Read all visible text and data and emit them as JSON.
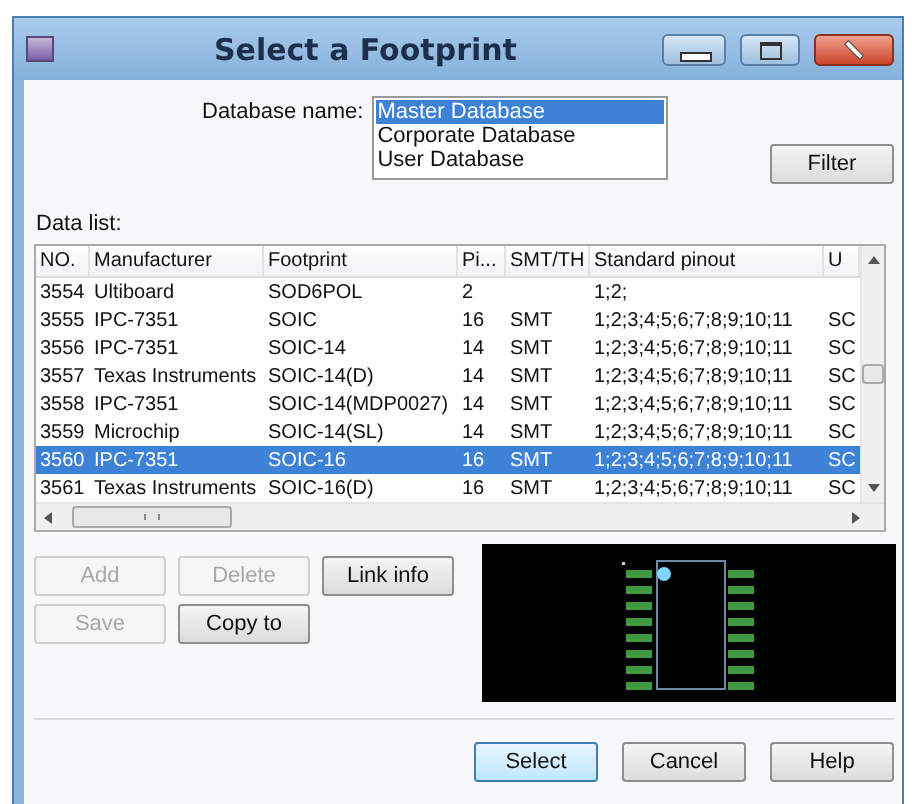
{
  "window": {
    "title": "Select a Footprint"
  },
  "database": {
    "label": "Database name:",
    "items": [
      {
        "label": "Master Database",
        "selected": true
      },
      {
        "label": "Corporate Database",
        "selected": false
      },
      {
        "label": "User Database",
        "selected": false
      }
    ]
  },
  "filter_button": {
    "label": "Filter"
  },
  "data_list": {
    "label": "Data list:",
    "columns": [
      "NO.",
      "Manufacturer",
      "Footprint",
      "Pi...",
      "SMT/TH",
      "Standard pinout",
      "U"
    ],
    "rows": [
      {
        "cells": [
          "3554",
          "Ultiboard",
          "SOD6POL",
          "2",
          "",
          "1;2;",
          ""
        ],
        "selected": false
      },
      {
        "cells": [
          "3555",
          "IPC-7351",
          "SOIC",
          "16",
          "SMT",
          "1;2;3;4;5;6;7;8;9;10;11",
          "SC"
        ],
        "selected": false
      },
      {
        "cells": [
          "3556",
          "IPC-7351",
          "SOIC-14",
          "14",
          "SMT",
          "1;2;3;4;5;6;7;8;9;10;11",
          "SC"
        ],
        "selected": false
      },
      {
        "cells": [
          "3557",
          "Texas Instruments",
          "SOIC-14(D)",
          "14",
          "SMT",
          "1;2;3;4;5;6;7;8;9;10;11",
          "SC"
        ],
        "selected": false
      },
      {
        "cells": [
          "3558",
          "IPC-7351",
          "SOIC-14(MDP0027)",
          "14",
          "SMT",
          "1;2;3;4;5;6;7;8;9;10;11",
          "SC"
        ],
        "selected": false
      },
      {
        "cells": [
          "3559",
          "Microchip",
          "SOIC-14(SL)",
          "14",
          "SMT",
          "1;2;3;4;5;6;7;8;9;10;11",
          "SC"
        ],
        "selected": false
      },
      {
        "cells": [
          "3560",
          "IPC-7351",
          "SOIC-16",
          "16",
          "SMT",
          "1;2;3;4;5;6;7;8;9;10;11",
          "SC"
        ],
        "selected": true
      },
      {
        "cells": [
          "3561",
          "Texas Instruments",
          "SOIC-16(D)",
          "16",
          "SMT",
          "1;2;3;4;5;6;7;8;9;10;11",
          "SC"
        ],
        "selected": false
      }
    ]
  },
  "actions": [
    {
      "label": "Add",
      "disabled": true
    },
    {
      "label": "Delete",
      "disabled": true
    },
    {
      "label": "Link info",
      "disabled": false
    },
    {
      "label": "Save",
      "disabled": true
    },
    {
      "label": "Copy to",
      "disabled": false
    }
  ],
  "footer_buttons": [
    {
      "label": "Select",
      "default": true
    },
    {
      "label": "Cancel",
      "default": false
    },
    {
      "label": "Help",
      "default": false
    }
  ]
}
